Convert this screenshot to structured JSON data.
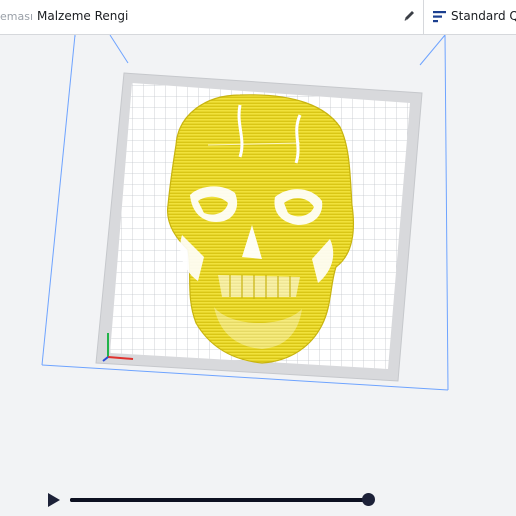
{
  "header": {
    "scheme_fragment": "eması",
    "material_color_label": "Malzeme Rengi",
    "profile_label": "Standard Qua",
    "icons": {
      "edit": "pencil-icon",
      "profile": "print-settings-icon"
    }
  },
  "viewport": {
    "model": "skull relief",
    "model_color": "#e7d62a",
    "build_plate_color": "#ffffff",
    "grid_color": "#b9bdc4",
    "volume_outline_color": "#5b9cff"
  },
  "playback": {
    "play_icon": "play-icon",
    "progress": 1.0
  }
}
